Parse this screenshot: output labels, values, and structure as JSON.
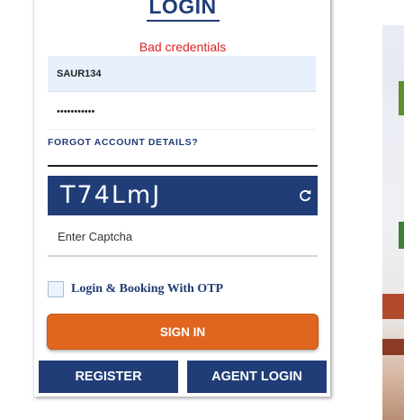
{
  "login": {
    "title": "LOGIN",
    "error_message": "Bad credentials",
    "username_value": "SAUR134",
    "password_mask": "•••••••••••",
    "forgot_link": "FORGOT ACCOUNT DETAILS?",
    "captcha_text": "T74LmJ",
    "captcha_placeholder": "Enter Captcha",
    "otp_label": "Login & Booking With OTP",
    "otp_checked": false,
    "signin_label": "SIGN IN",
    "register_label": "REGISTER",
    "agent_login_label": "AGENT LOGIN"
  },
  "icons": {
    "refresh": "refresh-icon"
  },
  "colors": {
    "primary_navy": "#213d77",
    "signin_orange": "#e0661f",
    "error_red": "#e02020",
    "autofill_blue": "#e8f0fe"
  }
}
